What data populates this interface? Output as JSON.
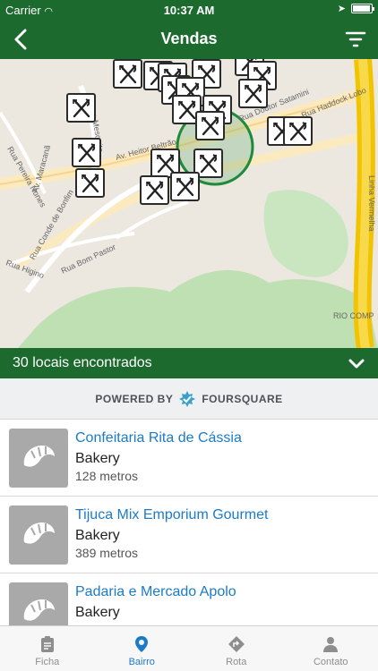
{
  "status": {
    "carrier": "Carrier",
    "time": "10:37 AM",
    "battery_level": 0.95
  },
  "nav": {
    "title": "Vendas",
    "back_icon": "chevron-left-icon",
    "filter_icon": "filter-icon"
  },
  "map": {
    "street_labels": [
      "Av. Maracanã",
      "Rua Pereira Nunes",
      "Rua Conde de Bonfim",
      "Rua Mesquita",
      "Av. Heitor Beltrão",
      "Rua Doutor Satamini",
      "Rua Haddock Lobo",
      "Linha Vermelha",
      "Rua Bom Pastor",
      "Rua Higino",
      "RIO COMP"
    ],
    "pin_icon": "fork-knife-icon",
    "pin_count_visible": 20
  },
  "results": {
    "count_label": "30 locais encontrados",
    "toggle_icon": "chevron-down-icon"
  },
  "powered": {
    "label": "POWERED BY",
    "brand": "FOURSQUARE"
  },
  "places": [
    {
      "name": "Confeitaria Rita de Cássia",
      "category": "Bakery",
      "distance": "128 metros",
      "icon": "croissant-icon"
    },
    {
      "name": "Tijuca Mix Emporium Gourmet",
      "category": "Bakery",
      "distance": "389 metros",
      "icon": "croissant-icon"
    },
    {
      "name": "Padaria e Mercado Apolo",
      "category": "Bakery",
      "distance": "",
      "icon": "croissant-icon"
    }
  ],
  "tabs": [
    {
      "label": "Ficha",
      "icon": "clipboard-icon",
      "active": false
    },
    {
      "label": "Bairro",
      "icon": "map-pin-icon",
      "active": true
    },
    {
      "label": "Rota",
      "icon": "directions-icon",
      "active": false
    },
    {
      "label": "Contato",
      "icon": "person-icon",
      "active": false
    }
  ],
  "colors": {
    "primary": "#1d6a2f",
    "link": "#1b7bc9",
    "highway": "#f2c300"
  }
}
